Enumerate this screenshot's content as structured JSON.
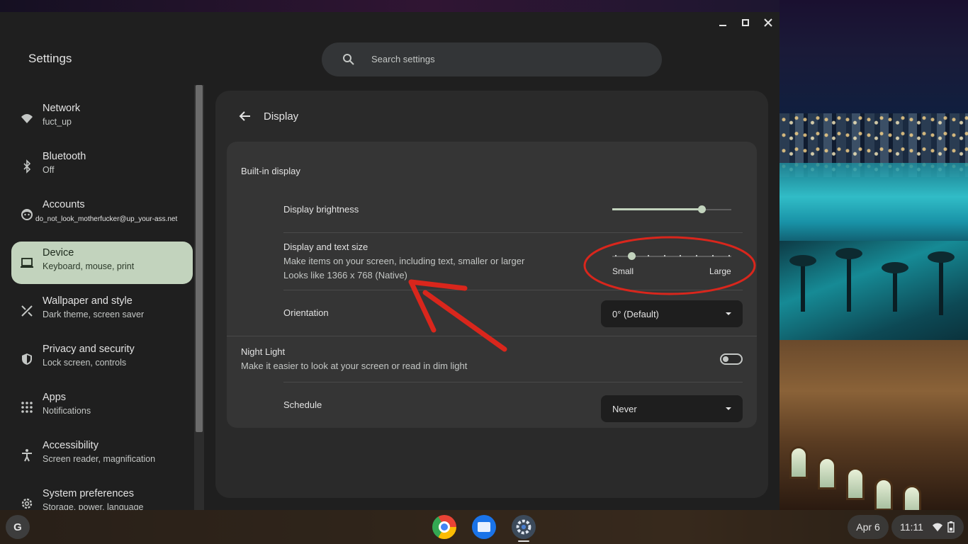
{
  "window": {
    "app_title": "Settings",
    "controls": {
      "minimize": "minimize-icon",
      "maximize": "maximize-icon",
      "close": "close-icon"
    }
  },
  "search": {
    "placeholder": "Search settings"
  },
  "sidebar": {
    "items": [
      {
        "label": "Network",
        "sub": "fuct_up",
        "icon": "wifi-icon"
      },
      {
        "label": "Bluetooth",
        "sub": "Off",
        "icon": "bluetooth-icon"
      },
      {
        "label": "Accounts",
        "sub": "do_not_look_motherfucker@up_your-ass.net",
        "icon": "account-icon"
      },
      {
        "label": "Device",
        "sub": "Keyboard, mouse, print",
        "icon": "laptop-icon",
        "active": true
      },
      {
        "label": "Wallpaper and style",
        "sub": "Dark theme, screen saver",
        "icon": "brush-icon"
      },
      {
        "label": "Privacy and security",
        "sub": "Lock screen, controls",
        "icon": "shield-icon"
      },
      {
        "label": "Apps",
        "sub": "Notifications",
        "icon": "apps-grid-icon"
      },
      {
        "label": "Accessibility",
        "sub": "Screen reader, magnification",
        "icon": "accessibility-icon"
      },
      {
        "label": "System preferences",
        "sub": "Storage, power, language",
        "icon": "gear-icon"
      }
    ]
  },
  "page": {
    "title": "Display",
    "section": "Built-in display",
    "brightness": {
      "label": "Display brightness",
      "level": 0.75
    },
    "text_size": {
      "label": "Display and text size",
      "description": "Make items on your screen, including text, smaller or larger",
      "resolution": "Looks like 1366 x 768 (Native)",
      "min_label": "Small",
      "max_label": "Large",
      "steps": 8,
      "selected_step": 1
    },
    "orientation": {
      "label": "Orientation",
      "value": "0° (Default)"
    },
    "night_light": {
      "label": "Night Light",
      "description": "Make it easier to look at your screen or read in dim light",
      "enabled": false
    },
    "schedule": {
      "label": "Schedule",
      "value": "Never"
    }
  },
  "shelf": {
    "launcher": "G",
    "apps": [
      "chrome-icon",
      "files-icon",
      "settings-icon"
    ],
    "date": "Apr 6",
    "time": "11:11"
  },
  "colors": {
    "accent": "#c2d3bd",
    "annotation": "#d9261c",
    "window_bg": "#1f1f1f",
    "card_bg": "#353535"
  }
}
